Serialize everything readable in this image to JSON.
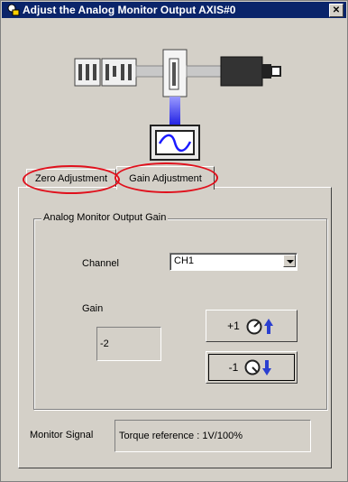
{
  "window": {
    "title": "Adjust the Analog Monitor Output AXIS#0",
    "close_label": "✕"
  },
  "tabs": [
    {
      "label": "Zero Adjustment"
    },
    {
      "label": "Gain Adjustment"
    }
  ],
  "group": {
    "title": "Analog Monitor Output Gain",
    "channel_label": "Channel",
    "channel_value": "CH1",
    "gain_label": "Gain",
    "gain_value": "-2",
    "plus_label": "+1",
    "minus_label": "-1"
  },
  "monitor": {
    "label": "Monitor Signal",
    "value": "Torque reference : 1V/100%"
  },
  "colors": {
    "highlight_ellipse": "#e0101c",
    "title_bar": "#0a246a",
    "face": "#d4d0c8",
    "signal_beam": "#3b3bff"
  }
}
